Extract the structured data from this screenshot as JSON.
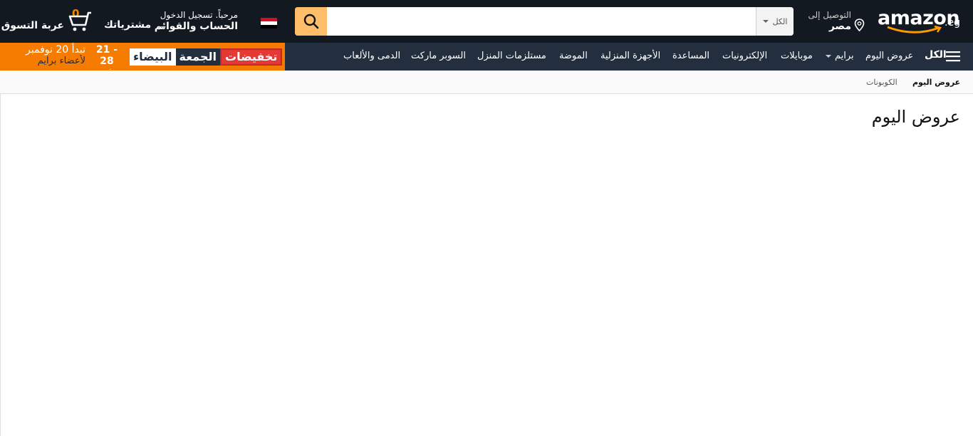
{
  "logo": {
    "text": "amazon",
    "suffix": ".eg"
  },
  "deliver": {
    "label": "التوصيل إلى",
    "location": "مصر"
  },
  "search": {
    "category": "الكل",
    "placeholder": "",
    "value": ""
  },
  "account": {
    "greeting": "مرحباً. تسجيل الدخول",
    "label": "الحساب والقوائم"
  },
  "orders": {
    "label": "مشترياتك"
  },
  "cart": {
    "count": "0",
    "label": "عربة التسوق"
  },
  "nav": {
    "all": "الكل",
    "items": [
      "عروض اليوم",
      "برايم",
      "موبايلات",
      "الإلكترونيات",
      "المساعدة",
      "الأجهزة المنزلية",
      "الموضة",
      "مستلزمات المنزل",
      "السوبر ماركت",
      "الدمى والألعاب"
    ]
  },
  "promo": {
    "part1": "البيضاء",
    "part2": "الجمعة",
    "part3": "تخفيضات",
    "dates": "21 - 28",
    "month": "نوفمبر",
    "prime_line1": "تبدأ 20 نوفمبر",
    "prime_line2": "لأعضاء برايم"
  },
  "subnav": {
    "active": "عروض اليوم",
    "other": "الكوبونات"
  },
  "page": {
    "title": "عروض اليوم"
  },
  "colors": {
    "topbar": "#131921",
    "navbar": "#232f3e",
    "search_button": "#febd69",
    "promo": "#f57c00",
    "accent": "#f08804"
  }
}
